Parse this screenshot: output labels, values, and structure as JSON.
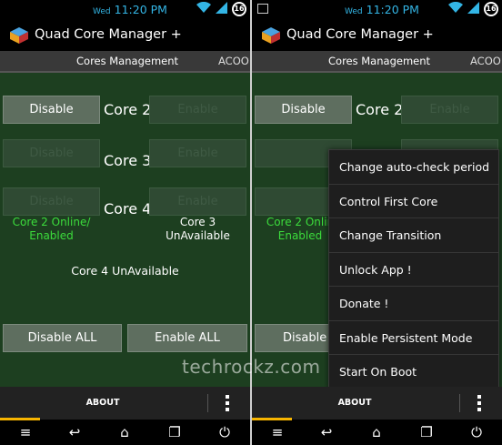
{
  "left": {
    "status": {
      "day": "Wed",
      "time": "11:20 PM",
      "battery": "16"
    },
    "app_title": "Quad Core Manager +",
    "tabs": [
      "Cores Management",
      "ACOO"
    ],
    "cores": [
      {
        "label": "Core 2",
        "left_btn": "Disable",
        "right_btn": "Enable"
      },
      {
        "label": "Core 3",
        "left_btn": "Disable",
        "right_btn": "Enable"
      },
      {
        "label": "Core 4",
        "left_btn": "Disable",
        "right_btn": "Enable"
      }
    ],
    "status_core2": "Core 2 Online/ Enabled",
    "status_core3": "Core 3 UnAvailable",
    "status_core4": "Core 4 UnAvailable",
    "disable_all": "Disable ALL",
    "enable_all": "Enable ALL",
    "about": "ABOUT"
  },
  "right": {
    "status": {
      "day": "Wed",
      "time": "11:20 PM",
      "battery": "16"
    },
    "app_title": "Quad Core Manager +",
    "tabs": [
      "Cores Management",
      "ACOO"
    ],
    "core2_label": "Core 2",
    "disable": "Disable",
    "enable": "Enable",
    "status_core2": "Core 2 Onlin Enabled",
    "disable_all": "Disable",
    "about": "ABOUT",
    "menu": [
      "Change auto-check period",
      "Control First Core",
      "Change Transition",
      "Unlock App !",
      "Donate !",
      "Enable Persistent Mode",
      "Start On Boot"
    ]
  },
  "watermark": "techrockz.com",
  "colors": {
    "content_bg": "#1d3f20",
    "status_blue": "#33b5e5",
    "online_green": "#3cdc3c",
    "progress_orange": "#f7b500"
  }
}
